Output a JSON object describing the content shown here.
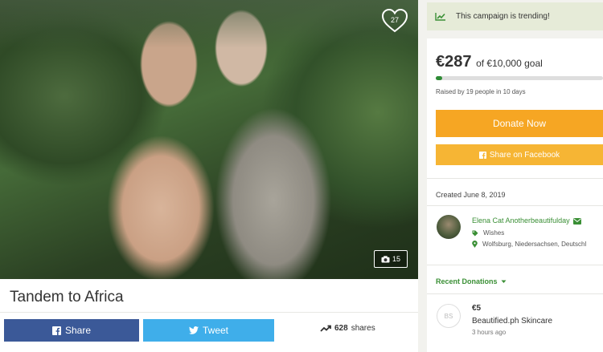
{
  "campaign": {
    "title": "Tandem to Africa",
    "like_count": "27",
    "photo_count": "15"
  },
  "share": {
    "facebook_label": "Share",
    "twitter_label": "Tweet",
    "share_count": "628",
    "shares_suffix": "shares"
  },
  "sidebar": {
    "trending_text": "This campaign is trending!",
    "amount_raised": "€287",
    "goal_text": "of €10,000 goal",
    "progress_fraction": 0.0287,
    "raised_by": "Raised by 19 people in 10 days",
    "donate_label": "Donate Now",
    "fb_share_label": "Share on Facebook",
    "created": "Created June 8, 2019",
    "organizer": {
      "name": "Elena Cat Anotherbeautifulday",
      "category": "Wishes",
      "location": "Wolfsburg, Niedersachsen, Deutschl"
    },
    "recent_donations_label": "Recent Donations",
    "donations": [
      {
        "initials": "BS",
        "amount": "€5",
        "name": "Beautified.ph Skincare",
        "time": "3 hours ago"
      }
    ]
  },
  "colors": {
    "facebook": "#3b5998",
    "twitter": "#3faeea",
    "donate": "#f6a623",
    "accent_green": "#3a8f35"
  }
}
